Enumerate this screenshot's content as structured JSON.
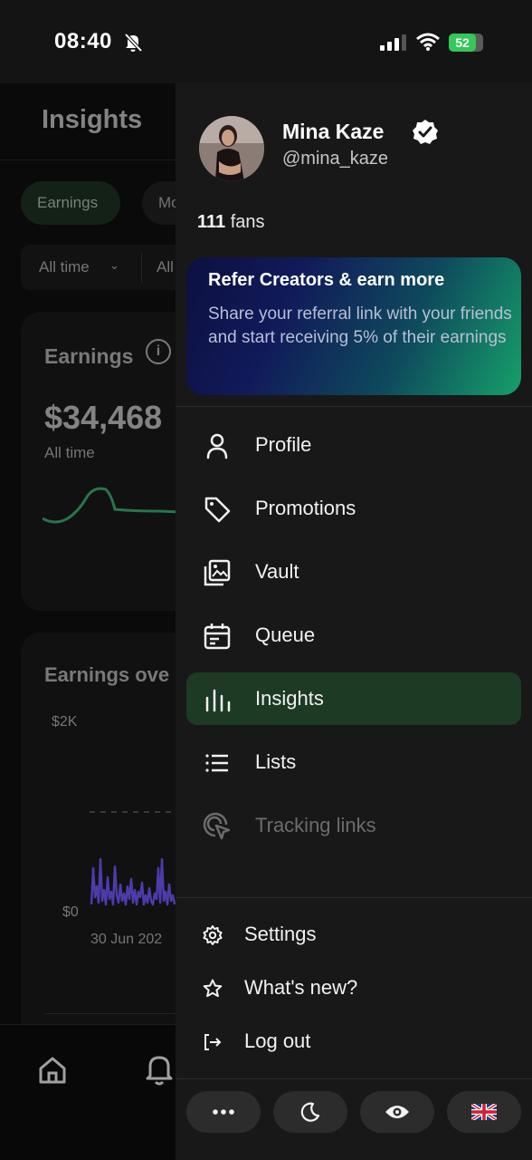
{
  "status_bar": {
    "time": "08:40",
    "battery": "52"
  },
  "background": {
    "title": "Insights",
    "filters": {
      "earnings": "Earnings",
      "more": "Mo"
    },
    "range": {
      "primary": "All time",
      "secondary": "All"
    },
    "earnings_card": {
      "label": "Earnings",
      "info_icon": "info-icon",
      "value": "$34,468",
      "period": "All time"
    },
    "chart_card": {
      "label": "Earnings ove",
      "y_max": "$2K",
      "y_min": "$0",
      "x_start": "30 Jun 202"
    },
    "tabs": [
      "home-icon",
      "bell-icon"
    ]
  },
  "drawer": {
    "profile": {
      "name": "Mina Kaze",
      "handle": "@mina_kaze",
      "fans_count": "111",
      "fans_label": "fans"
    },
    "promo": {
      "title": "Refer Creators & earn more",
      "description": "Share your referral link with your friends and start receiving 5% of their earnings"
    },
    "menu": [
      {
        "label": "Profile",
        "icon": "person-icon"
      },
      {
        "label": "Promotions",
        "icon": "tag-icon"
      },
      {
        "label": "Vault",
        "icon": "gallery-icon"
      },
      {
        "label": "Queue",
        "icon": "calendar-icon"
      },
      {
        "label": "Insights",
        "icon": "bar-chart-icon",
        "active": true
      },
      {
        "label": "Lists",
        "icon": "list-icon"
      },
      {
        "label": "Tracking links",
        "icon": "cursor-target-icon",
        "disabled": true
      }
    ],
    "secondary": [
      {
        "label": "Settings",
        "icon": "gear-icon"
      },
      {
        "label": "What's new?",
        "icon": "star-icon"
      },
      {
        "label": "Log out",
        "icon": "logout-icon"
      }
    ],
    "bottom_buttons": [
      "more-icon",
      "moon-icon",
      "eye-icon",
      "uk-flag-icon"
    ]
  },
  "colors": {
    "active_bg": "#1d3a24",
    "chart_line": "#2f8a5a",
    "chart_bars": "#5b46c8"
  }
}
